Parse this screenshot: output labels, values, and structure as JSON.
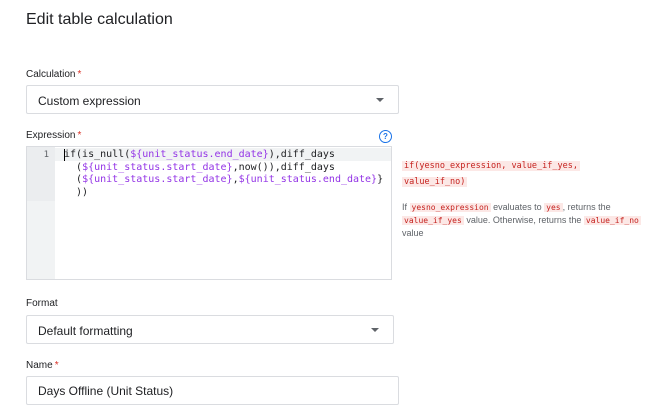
{
  "dialog": {
    "title": "Edit table calculation"
  },
  "calculation": {
    "label": "Calculation",
    "required_mark": "*",
    "value": "Custom expression"
  },
  "expression": {
    "label": "Expression",
    "required_mark": "*",
    "help_icon": "help-circle-icon",
    "line_number": "1",
    "code_lines": [
      [
        "if(is_null(",
        "${unit_status.end_date}",
        "),diff_days"
      ],
      [
        "  (",
        "${unit_status.start_date}",
        ",now()),diff_days"
      ],
      [
        "  (",
        "${unit_status.start_date}",
        ",",
        "${unit_status.end_date}",
        "}"
      ],
      [
        "  ))"
      ]
    ]
  },
  "function_help": {
    "signature_line1": "if(yesno_expression, value_if_yes,",
    "signature_line2": "value_if_no)",
    "desc_if": "If",
    "desc_kw1": "yesno_expression",
    "desc_evaluates": "evaluates to",
    "desc_kw2": "yes",
    "desc_returns": ", returns the",
    "desc_kw3": "value_if_yes",
    "desc_otherwise": "value. Otherwise, returns the",
    "desc_kw4": "value_if_no",
    "desc_value": "value"
  },
  "format": {
    "label": "Format",
    "value": "Default formatting"
  },
  "name": {
    "label": "Name",
    "required_mark": "*",
    "value": "Days Offline (Unit Status)"
  },
  "colors": {
    "accent": "#1a73e8",
    "required": "#d93025",
    "variable": "#9334e6",
    "keyword_bg": "#fce8e6"
  }
}
